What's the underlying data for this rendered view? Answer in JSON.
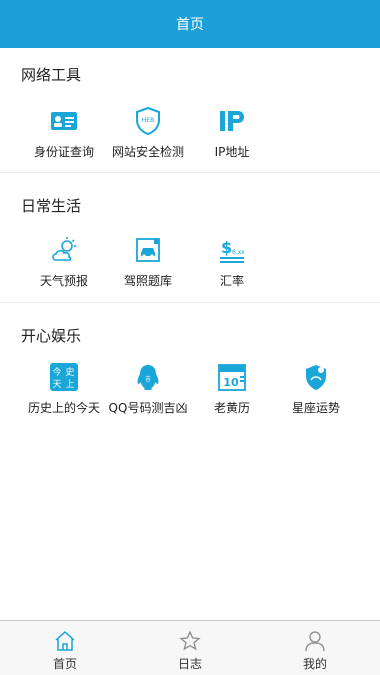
{
  "header": {
    "title": "首页"
  },
  "sections": [
    {
      "title": "网络工具",
      "items": [
        {
          "label": "身份证查询",
          "icon": "id-card-icon"
        },
        {
          "label": "网站安全检测",
          "icon": "web-security-shield-icon"
        },
        {
          "label": "IP地址",
          "icon": "ip-address-icon"
        }
      ]
    },
    {
      "title": "日常生活",
      "items": [
        {
          "label": "天气预报",
          "icon": "weather-sun-cloud-icon"
        },
        {
          "label": "驾照题库",
          "icon": "driving-license-car-icon"
        },
        {
          "label": "汇率",
          "icon": "exchange-rate-dollar-icon"
        }
      ]
    },
    {
      "title": "开心娱乐",
      "items": [
        {
          "label": "历史上的今天",
          "icon": "history-today-icon"
        },
        {
          "label": "QQ号码测吉凶",
          "icon": "qq-penguin-icon"
        },
        {
          "label": "老黄历",
          "icon": "calendar-icon"
        },
        {
          "label": "星座运势",
          "icon": "constellation-icon"
        }
      ]
    }
  ],
  "tabbar": {
    "tabs": [
      {
        "label": "首页",
        "icon": "home-icon",
        "active": true
      },
      {
        "label": "日志",
        "icon": "star-icon",
        "active": false
      },
      {
        "label": "我的",
        "icon": "user-icon",
        "active": false
      }
    ]
  },
  "colors": {
    "accent": "#1d9fd8",
    "icon": "#1aa6d8"
  }
}
